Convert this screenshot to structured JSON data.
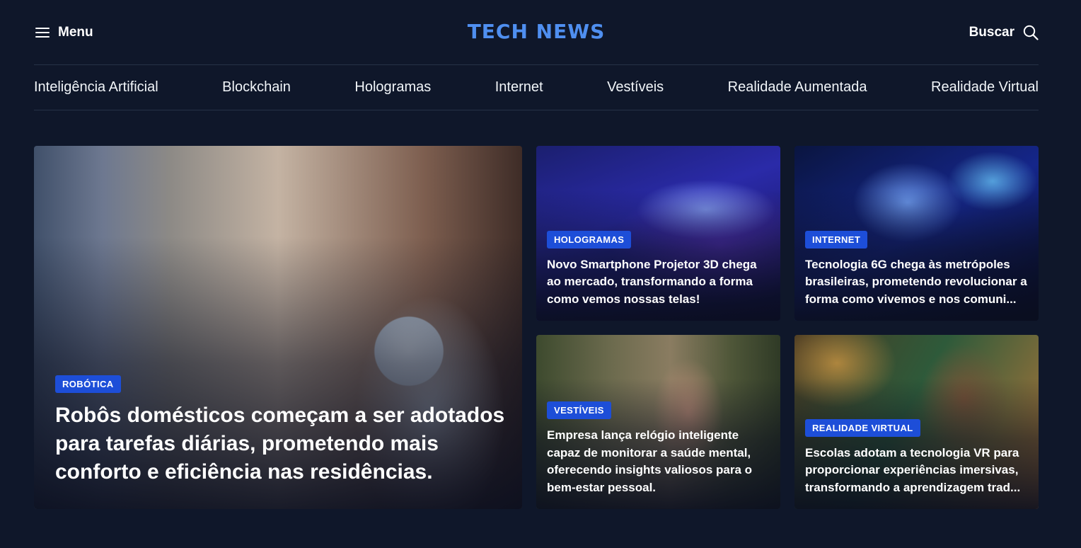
{
  "header": {
    "menu_label": "Menu",
    "logo": "TECH NEWS",
    "search_label": "Buscar"
  },
  "nav": {
    "items": [
      "Inteligência Artificial",
      "Blockchain",
      "Hologramas",
      "Internet",
      "Vestíveis",
      "Realidade Aumentada",
      "Realidade Virtual"
    ]
  },
  "articles": [
    {
      "category": "ROBÓTICA",
      "title": "Robôs domésticos começam a ser adotados para tarefas diárias, prometendo mais conforto e eficiência nas residências."
    },
    {
      "category": "HOLOGRAMAS",
      "title": "Novo Smartphone Projetor 3D chega ao mercado, transformando a forma como vemos nossas telas!"
    },
    {
      "category": "INTERNET",
      "title": "Tecnologia 6G chega às metrópoles brasileiras, prometendo revolucionar a forma como vivemos e nos comuni..."
    },
    {
      "category": "VESTÍVEIS",
      "title": "Empresa lança relógio inteligente capaz de monitorar a saúde mental, oferecendo insights valiosos para o bem-estar pessoal."
    },
    {
      "category": "REALIDADE VIRTUAL",
      "title": "Escolas adotam a tecnologia VR para proporcionar experiências imersivas, transformando a aprendizagem trad..."
    }
  ],
  "colors": {
    "background": "#0f172a",
    "logo": "#4f8ff0",
    "badge": "#1d4ed8"
  },
  "icons": [
    "hamburger-menu-icon",
    "search-icon"
  ]
}
